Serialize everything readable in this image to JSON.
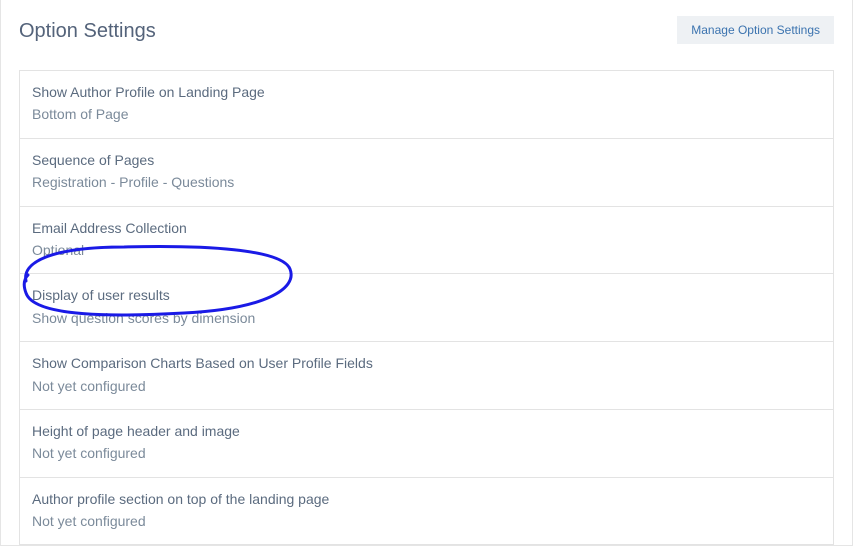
{
  "header": {
    "title": "Option Settings",
    "manage_button": "Manage Option Settings"
  },
  "settings": [
    {
      "label": "Show Author Profile on Landing Page",
      "value": "Bottom of Page"
    },
    {
      "label": "Sequence of Pages",
      "value": "Registration - Profile - Questions"
    },
    {
      "label": "Email Address Collection",
      "value": "Optional"
    },
    {
      "label": "Display of user results",
      "value": "Show question scores by dimension"
    },
    {
      "label": "Show Comparison Charts Based on User Profile Fields",
      "value": "Not yet configured"
    },
    {
      "label": "Height of page header and image",
      "value": "Not yet configured"
    },
    {
      "label": "Author profile section on top of the landing page",
      "value": "Not yet configured"
    }
  ]
}
